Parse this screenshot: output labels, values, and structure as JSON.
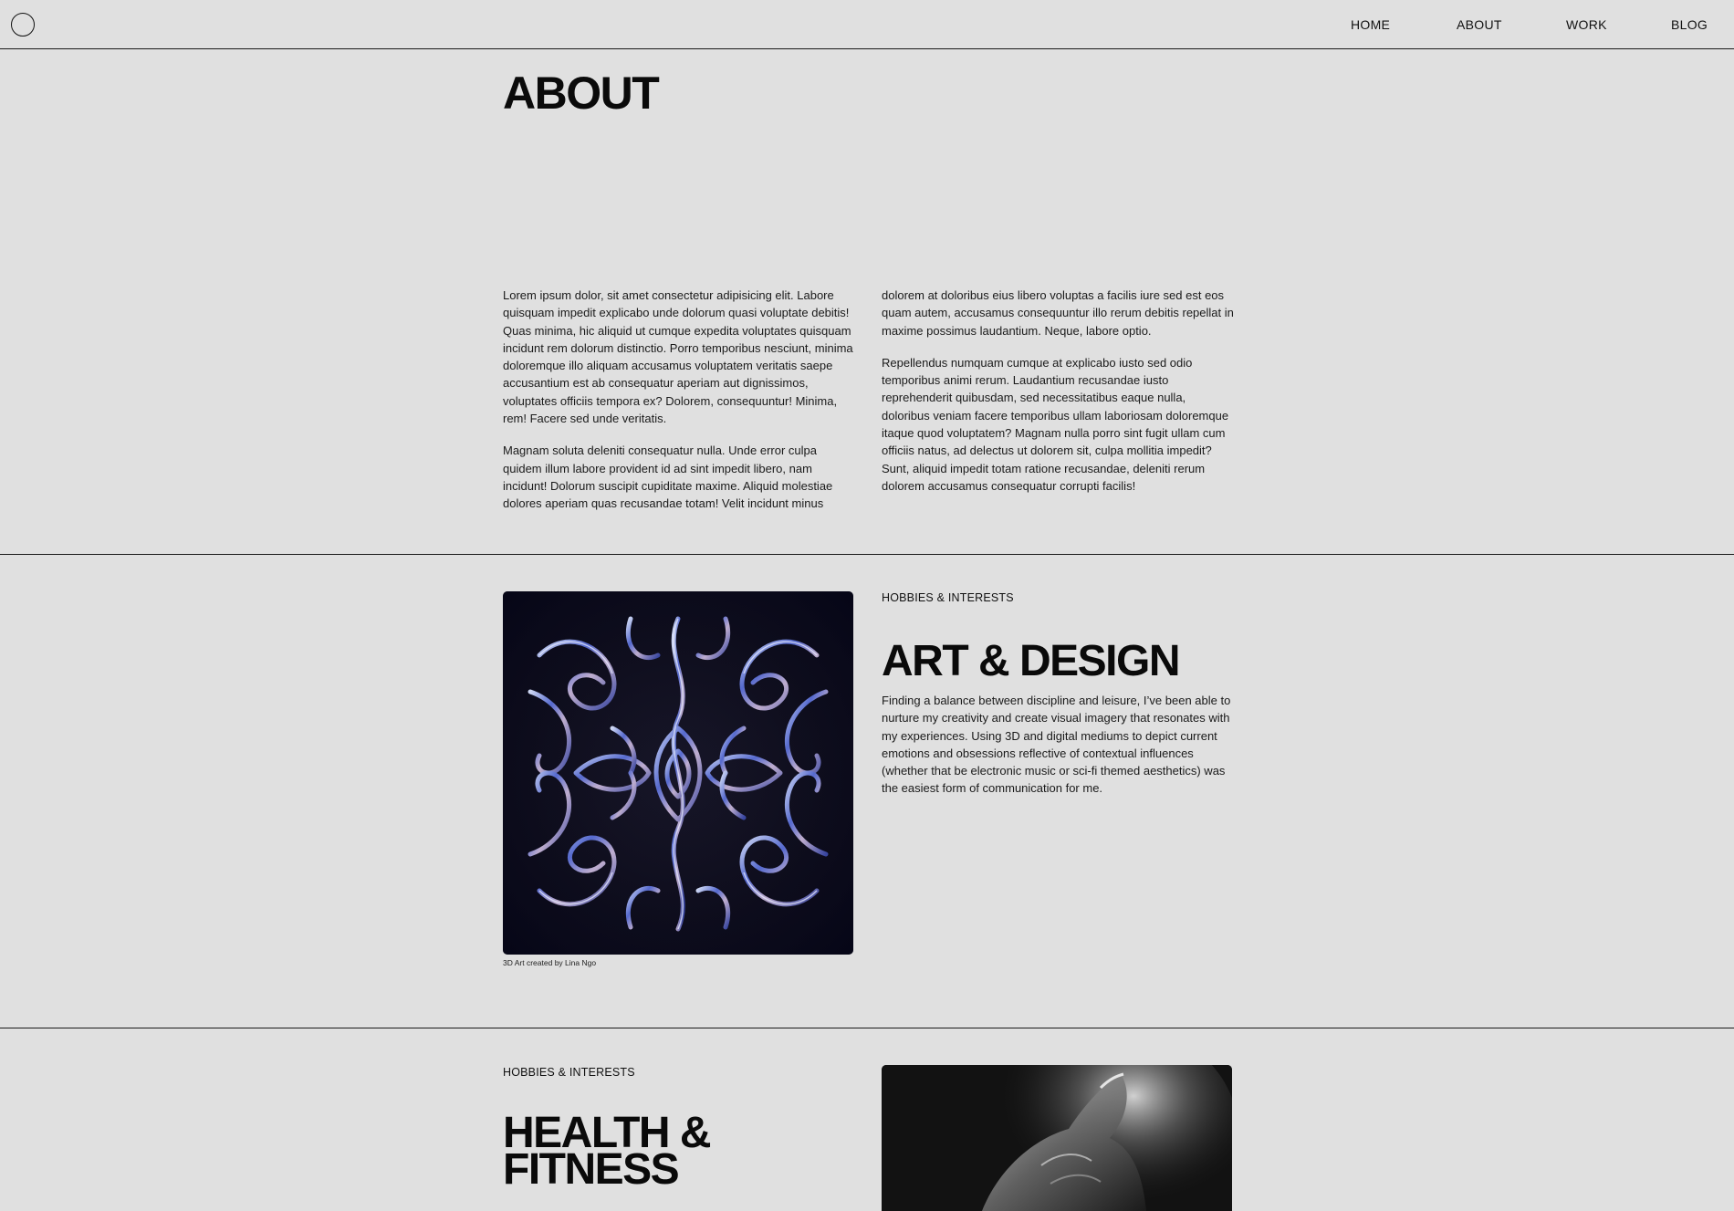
{
  "header": {
    "nav": [
      {
        "label": "HOME"
      },
      {
        "label": "ABOUT"
      },
      {
        "label": "WORK"
      },
      {
        "label": "BLOG"
      }
    ]
  },
  "about": {
    "title": "ABOUT",
    "col1": [
      "Lorem ipsum dolor, sit amet consectetur adipisicing elit. Labore quisquam impedit explicabo unde dolorum quasi voluptate debitis! Quas minima, hic aliquid ut cumque expedita voluptates quisquam incidunt rem dolorum distinctio. Porro temporibus nesciunt, minima doloremque illo aliquam accusamus voluptatem veritatis saepe accusantium est ab consequatur aperiam aut dignissimos, voluptates officiis tempora ex? Dolorem, consequuntur! Minima, rem! Facere sed unde veritatis.",
      "Magnam soluta deleniti consequatur nulla. Unde error culpa quidem illum labore provident id ad sint impedit libero, nam incidunt! Dolorum suscipit cupiditate maxime. Aliquid molestiae dolores aperiam quas recusandae totam! Velit incidunt minus"
    ],
    "col2": [
      "dolorem at doloribus eius libero voluptas a facilis iure sed est eos quam autem, accusamus consequuntur illo rerum debitis repellat in maxime possimus laudantium. Neque, labore optio.",
      "Repellendus numquam cumque at explicabo iusto sed odio temporibus animi rerum. Laudantium recusandae iusto reprehenderit quibusdam, sed necessitatibus eaque nulla, doloribus veniam facere temporibus ullam laboriosam doloremque itaque quod voluptatem? Magnam nulla porro sint fugit ullam cum officiis natus, ad delectus ut dolorem sit, culpa mollitia impedit? Sunt, aliquid impedit totam ratione recusandae, deleniti rerum dolorem accusamus consequatur corrupti facilis!"
    ]
  },
  "art": {
    "eyebrow": "HOBBIES & INTERESTS",
    "title": "ART & DESIGN",
    "body": "Finding a balance between discipline and leisure, I’ve been able to nurture my creativity and create visual imagery that resonates with my experiences. Using 3D and digital mediums to depict current emotions and obsessions reflective of contextual influences (whether that be electronic music or sci-fi themed aesthetics) was the easiest form of communication for me.",
    "caption": "3D Art created by Lina Ngo"
  },
  "health": {
    "eyebrow": "HOBBIES & INTERESTS",
    "title": "HEALTH & FITNESS"
  }
}
